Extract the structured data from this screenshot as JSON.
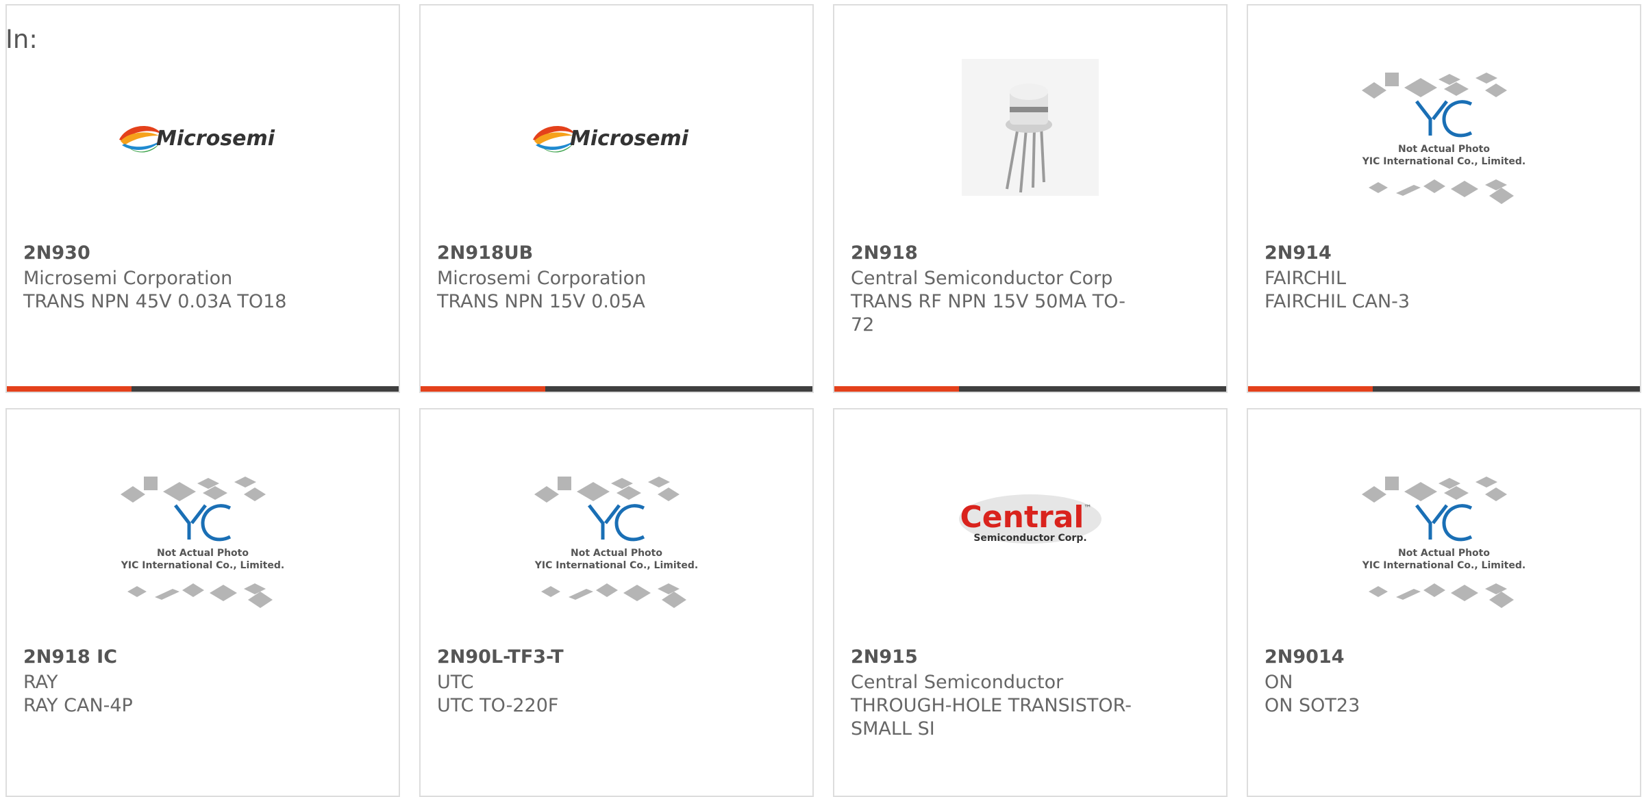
{
  "page": {
    "in_label": "In:"
  },
  "products": [
    {
      "part_number": "2N930",
      "manufacturer": "Microsemi Corporation",
      "description": "TRANS NPN 45V 0.03A TO18",
      "image": "microsemi-logo"
    },
    {
      "part_number": "2N918UB",
      "manufacturer": "Microsemi Corporation",
      "description": "TRANS NPN 15V 0.05A",
      "image": "microsemi-logo"
    },
    {
      "part_number": "2N918",
      "manufacturer": "Central Semiconductor Corp",
      "description": "TRANS RF NPN 15V 50MA TO-72",
      "image": "to72-transistor-photo"
    },
    {
      "part_number": "2N914",
      "manufacturer": "FAIRCHIL",
      "description": "FAIRCHIL CAN-3",
      "image": "yic-placeholder"
    },
    {
      "part_number": "2N918 IC",
      "manufacturer": "RAY",
      "description": "RAY CAN-4P",
      "image": "yic-placeholder"
    },
    {
      "part_number": "2N90L-TF3-T",
      "manufacturer": "UTC",
      "description": "UTC TO-220F",
      "image": "yic-placeholder"
    },
    {
      "part_number": "2N915",
      "manufacturer": "Central Semiconductor",
      "description": "THROUGH-HOLE TRANSISTOR-SMALL SI",
      "image": "central-logo"
    },
    {
      "part_number": "2N9014",
      "manufacturer": "ON",
      "description": "ON SOT23",
      "image": "yic-placeholder"
    }
  ],
  "logos": {
    "microsemi_text": "Microsemi",
    "central_text": "Central",
    "central_tm": "™",
    "central_sub": "Semiconductor Corp.",
    "yic_text": "YIC",
    "yic_line1": "Not Actual Photo",
    "yic_line2": "YIC International Co., Limited."
  },
  "colors": {
    "accent_bar": "#e4411b",
    "dark_bar": "#3f3f3f",
    "yic_blue": "#1a6fb5",
    "central_red": "#d9231d"
  }
}
